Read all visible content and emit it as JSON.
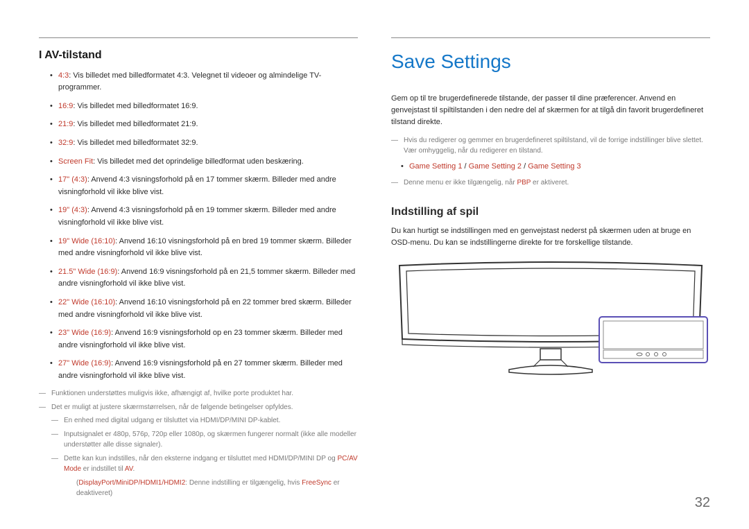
{
  "left": {
    "heading": "I AV-tilstand",
    "items": [
      {
        "label": "4:3",
        "rest": ": Vis billedet med billedformatet 4:3. Velegnet til videoer og almindelige TV-programmer."
      },
      {
        "label": "16:9",
        "rest": ": Vis billedet med billedformatet 16:9."
      },
      {
        "label": "21:9",
        "rest": ": Vis billedet med billedformatet 21:9."
      },
      {
        "label": "32:9",
        "rest": ": Vis billedet med billedformatet 32:9."
      },
      {
        "label": "Screen Fit",
        "rest": ": Vis billedet med det oprindelige billedformat uden beskæring."
      },
      {
        "label": "17\" (4:3)",
        "rest": ": Anvend 4:3 visningsforhold på en 17 tommer skærm. Billeder med andre visningforhold vil ikke blive vist."
      },
      {
        "label": "19\" (4:3)",
        "rest": ": Anvend 4:3 visningsforhold på en 19 tommer skærm. Billeder med andre visningforhold vil ikke blive vist."
      },
      {
        "label": "19\" Wide (16:10)",
        "rest": ": Anvend 16:10 visningsforhold på en bred 19 tommer skærm. Billeder med andre visningforhold vil ikke blive vist."
      },
      {
        "label": "21.5\" Wide (16:9)",
        "rest": ": Anvend 16:9 visningsforhold på en 21,5 tommer skærm. Billeder med andre visningforhold vil ikke blive vist."
      },
      {
        "label": "22\" Wide (16:10)",
        "rest": ": Anvend 16:10 visningsforhold på en 22 tommer bred skærm. Billeder med andre visningforhold vil ikke blive vist."
      },
      {
        "label": "23\" Wide (16:9)",
        "rest": ": Anvend 16:9 visningsforhold op en 23 tommer skærm. Billeder med andre visningforhold vil ikke blive vist."
      },
      {
        "label": "27\" Wide (16:9)",
        "rest": ": Anvend 16:9 visningsforhold på en 27 tommer skærm. Billeder med andre visningforhold vil ikke blive vist."
      }
    ],
    "notes": {
      "n1": "Funktionen understøttes muligvis ikke, afhængigt af, hvilke porte produktet har.",
      "n2": "Det er muligt at justere skærmstørrelsen, når de følgende betingelser opfyldes.",
      "n2a": "En enhed med digital udgang er tilsluttet via HDMI/DP/MINI DP-kablet.",
      "n2b": "Inputsignalet er 480p, 576p, 720p eller 1080p, og skærmen fungerer normalt (ikke alle modeller understøtter alle disse signaler).",
      "n2c_pre": "Dette kan kun indstilles, når den eksterne indgang er tilsluttet med HDMI/DP/MINI DP og ",
      "n2c_hl1": "PC/AV Mode",
      "n2c_mid": " er indstillet til ",
      "n2c_hl2": "AV",
      "n2c_post": ".",
      "n2d_pre": "(",
      "n2d_hl": "DisplayPort/MiniDP/HDMI1/HDMI2",
      "n2d_mid": ": Denne indstilling er tilgængelig, hvis ",
      "n2d_hl2": "FreeSync",
      "n2d_post": " er deaktiveret)"
    }
  },
  "right": {
    "title": "Save Settings",
    "p1": "Gem op til tre brugerdefinerede tilstande, der passer til dine præferencer. Anvend en genvejstast til spiltilstanden i den nedre del af skærmen for at tilgå din favorit brugerdefineret tilstand direkte.",
    "note1": "Hvis du redigerer og gemmer en brugerdefineret spiltilstand, vil de forrige indstillinger blive slettet. Vær omhyggelig, når du redigerer en tilstand.",
    "bullet_a": "Game Setting 1",
    "bullet_sep1": " / ",
    "bullet_b": "Game Setting 2",
    "bullet_sep2": " / ",
    "bullet_c": "Game Setting 3",
    "note2_pre": "Denne menu er ikke tilgængelig, når ",
    "note2_hl": "PBP",
    "note2_post": " er aktiveret.",
    "sub_head": "Indstilling af spil",
    "p2": "Du kan hurtigt se indstillingen med en genvejstast nederst på skærmen uden at bruge en OSD-menu. Du kan se indstillingerne direkte for tre forskellige tilstande."
  },
  "page_number": "32"
}
